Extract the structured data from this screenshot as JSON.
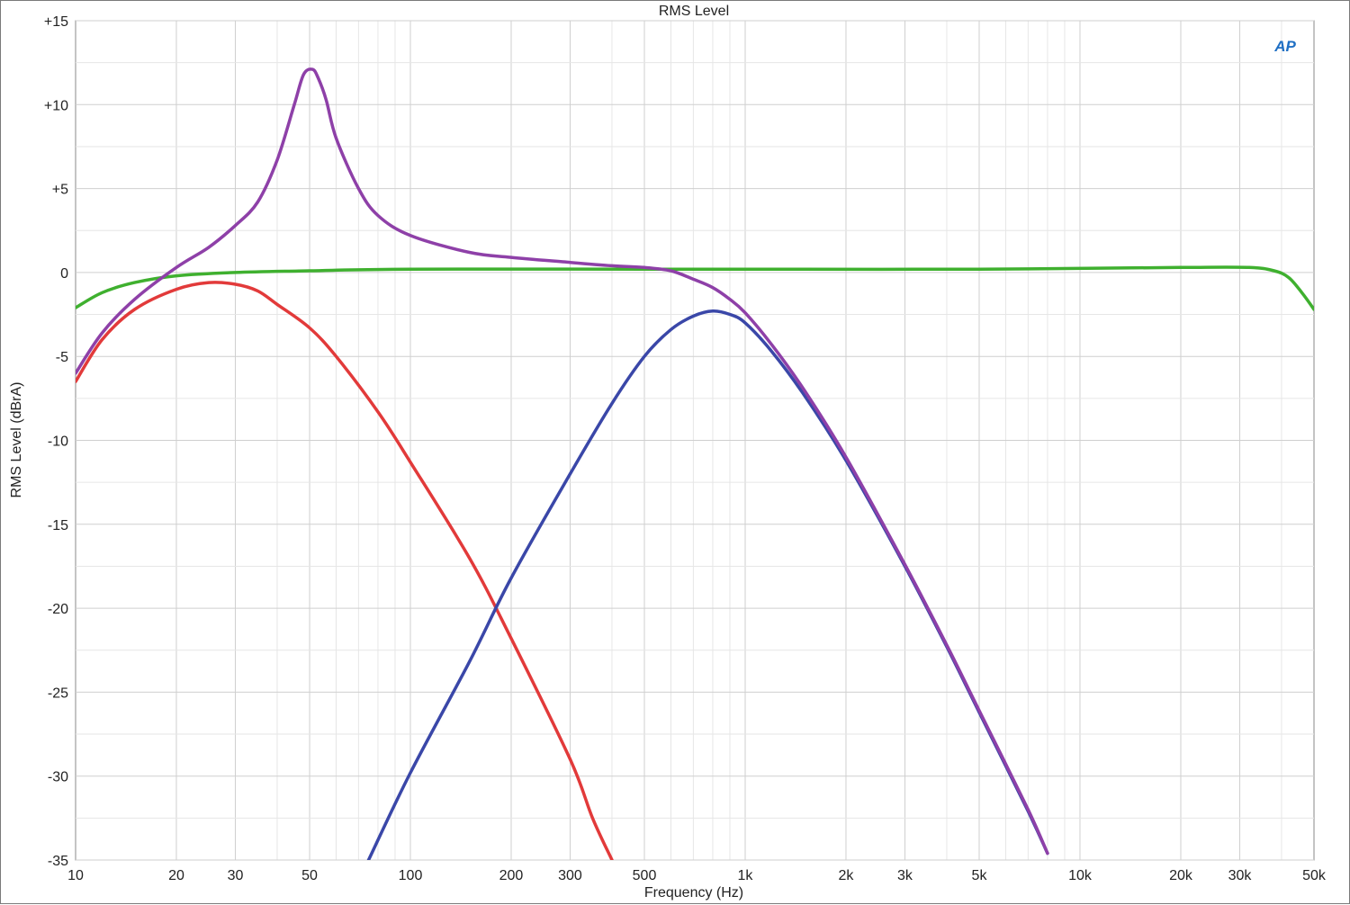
{
  "chart_data": {
    "type": "line",
    "title": "RMS Level",
    "xlabel": "Frequency (Hz)",
    "ylabel": "RMS Level (dBrA)",
    "xscale": "log",
    "xlim": [
      10,
      50000
    ],
    "ylim": [
      -35,
      15
    ],
    "grid": true,
    "logo": "AP",
    "xticks": [
      {
        "v": 10,
        "label": "10"
      },
      {
        "v": 20,
        "label": "20"
      },
      {
        "v": 30,
        "label": "30"
      },
      {
        "v": 50,
        "label": "50"
      },
      {
        "v": 100,
        "label": "100"
      },
      {
        "v": 200,
        "label": "200"
      },
      {
        "v": 300,
        "label": "300"
      },
      {
        "v": 500,
        "label": "500"
      },
      {
        "v": 1000,
        "label": "1k"
      },
      {
        "v": 2000,
        "label": "2k"
      },
      {
        "v": 3000,
        "label": "3k"
      },
      {
        "v": 5000,
        "label": "5k"
      },
      {
        "v": 10000,
        "label": "10k"
      },
      {
        "v": 20000,
        "label": "20k"
      },
      {
        "v": 30000,
        "label": "30k"
      },
      {
        "v": 50000,
        "label": "50k"
      }
    ],
    "yticks": [
      {
        "v": 15,
        "label": "+15"
      },
      {
        "v": 10,
        "label": "+10"
      },
      {
        "v": 5,
        "label": "+5"
      },
      {
        "v": 0,
        "label": "0"
      },
      {
        "v": -5,
        "label": "-5"
      },
      {
        "v": -10,
        "label": "-10"
      },
      {
        "v": -15,
        "label": "-15"
      },
      {
        "v": -20,
        "label": "-20"
      },
      {
        "v": -25,
        "label": "-25"
      },
      {
        "v": -30,
        "label": "-30"
      },
      {
        "v": -35,
        "label": "-35"
      }
    ],
    "series": [
      {
        "color": "#3fb02f",
        "points": [
          [
            10,
            -2.1
          ],
          [
            12,
            -1.2
          ],
          [
            15,
            -0.6
          ],
          [
            20,
            -0.2
          ],
          [
            30,
            0.0
          ],
          [
            50,
            0.1
          ],
          [
            100,
            0.2
          ],
          [
            500,
            0.2
          ],
          [
            1000,
            0.2
          ],
          [
            5000,
            0.2
          ],
          [
            20000,
            0.3
          ],
          [
            32000,
            0.3
          ],
          [
            38000,
            0.1
          ],
          [
            42000,
            -0.3
          ],
          [
            46000,
            -1.2
          ],
          [
            50000,
            -2.2
          ]
        ]
      },
      {
        "color": "#e23a3a",
        "points": [
          [
            10,
            -6.5
          ],
          [
            12,
            -4.0
          ],
          [
            15,
            -2.2
          ],
          [
            20,
            -1.0
          ],
          [
            25,
            -0.6
          ],
          [
            30,
            -0.7
          ],
          [
            35,
            -1.1
          ],
          [
            40,
            -1.9
          ],
          [
            50,
            -3.3
          ],
          [
            60,
            -5.0
          ],
          [
            80,
            -8.3
          ],
          [
            100,
            -11.3
          ],
          [
            150,
            -17.0
          ],
          [
            200,
            -21.8
          ],
          [
            300,
            -29.0
          ],
          [
            350,
            -32.5
          ],
          [
            400,
            -35.0
          ]
        ]
      },
      {
        "color": "#3a47a8",
        "points": [
          [
            75,
            -35.0
          ],
          [
            100,
            -29.8
          ],
          [
            150,
            -23.2
          ],
          [
            200,
            -18.2
          ],
          [
            300,
            -12.0
          ],
          [
            400,
            -7.8
          ],
          [
            500,
            -5.0
          ],
          [
            600,
            -3.4
          ],
          [
            700,
            -2.6
          ],
          [
            800,
            -2.3
          ],
          [
            900,
            -2.5
          ],
          [
            1000,
            -3.0
          ],
          [
            1200,
            -4.7
          ],
          [
            1500,
            -7.3
          ],
          [
            2000,
            -11.2
          ],
          [
            3000,
            -17.5
          ],
          [
            4000,
            -22.3
          ],
          [
            5000,
            -26.2
          ],
          [
            7000,
            -32.1
          ],
          [
            8000,
            -34.6
          ]
        ]
      },
      {
        "color": "#8e40a8",
        "points": [
          [
            10,
            -6.0
          ],
          [
            12,
            -3.6
          ],
          [
            15,
            -1.6
          ],
          [
            20,
            0.3
          ],
          [
            25,
            1.5
          ],
          [
            30,
            2.8
          ],
          [
            35,
            4.2
          ],
          [
            40,
            6.7
          ],
          [
            45,
            10.0
          ],
          [
            48,
            11.8
          ],
          [
            51,
            12.1
          ],
          [
            53,
            11.6
          ],
          [
            56,
            10.3
          ],
          [
            60,
            8.0
          ],
          [
            70,
            5.0
          ],
          [
            80,
            3.4
          ],
          [
            100,
            2.2
          ],
          [
            150,
            1.2
          ],
          [
            200,
            0.9
          ],
          [
            300,
            0.6
          ],
          [
            400,
            0.4
          ],
          [
            500,
            0.3
          ],
          [
            600,
            0.1
          ],
          [
            700,
            -0.4
          ],
          [
            800,
            -0.9
          ],
          [
            900,
            -1.6
          ],
          [
            1000,
            -2.4
          ],
          [
            1200,
            -4.3
          ],
          [
            1500,
            -7.0
          ],
          [
            2000,
            -11.0
          ],
          [
            3000,
            -17.4
          ],
          [
            4000,
            -22.2
          ],
          [
            5000,
            -26.1
          ],
          [
            7000,
            -32.0
          ],
          [
            8000,
            -34.6
          ]
        ]
      }
    ]
  }
}
